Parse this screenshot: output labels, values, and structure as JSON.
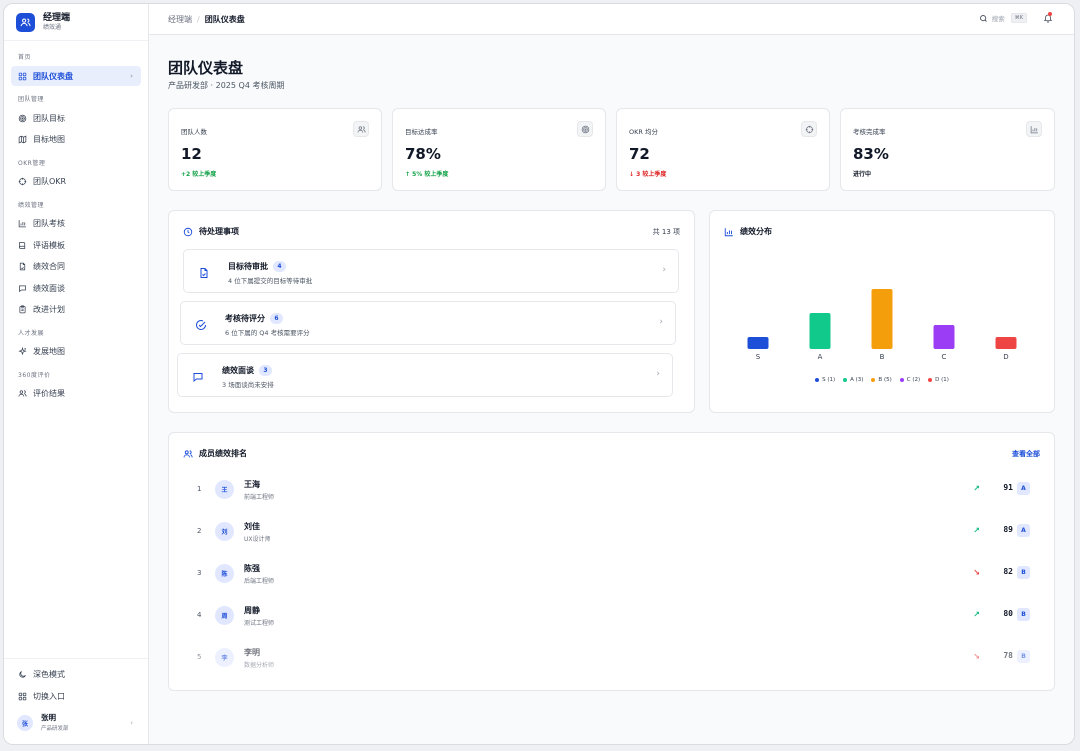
{
  "brand": {
    "name": "经理端",
    "sub": "绩效通"
  },
  "sidebar": {
    "groups": [
      {
        "title": "首页",
        "items": [
          {
            "label": "团队仪表盘",
            "icon": "dashboard-icon",
            "active": true
          }
        ]
      },
      {
        "title": "团队管理",
        "items": [
          {
            "label": "团队目标",
            "icon": "target-icon"
          },
          {
            "label": "目标地图",
            "icon": "map-icon"
          }
        ]
      },
      {
        "title": "OKR管理",
        "items": [
          {
            "label": "团队OKR",
            "icon": "crosshair-icon"
          }
        ]
      },
      {
        "title": "绩效管理",
        "items": [
          {
            "label": "团队考核",
            "icon": "bar-chart-icon"
          },
          {
            "label": "评语模板",
            "icon": "book-icon"
          },
          {
            "label": "绩效合同",
            "icon": "contract-icon"
          },
          {
            "label": "绩效面谈",
            "icon": "chat-icon"
          },
          {
            "label": "改进计划",
            "icon": "clipboard-icon"
          }
        ]
      },
      {
        "title": "人才发展",
        "items": [
          {
            "label": "发展地图",
            "icon": "sparkle-icon"
          }
        ]
      },
      {
        "title": "360度评价",
        "items": [
          {
            "label": "评价结果",
            "icon": "users-icon"
          }
        ]
      }
    ],
    "dark_mode": "深色模式",
    "switch_entry": "切换入口",
    "user": {
      "avatar": "张",
      "name": "张明",
      "dept": "产品研发部"
    }
  },
  "topbar": {
    "crumb_root": "经理端",
    "crumb_current": "团队仪表盘",
    "search_label": "搜索",
    "search_kbd": "⌘K"
  },
  "page": {
    "title": "团队仪表盘",
    "subtitle": "产品研发部 · 2025 Q4 考核周期"
  },
  "stats": [
    {
      "label": "团队人数",
      "value": "12",
      "delta": "+2 较上季度",
      "delta_color": "#16a34a",
      "icon": "users-icon"
    },
    {
      "label": "目标达成率",
      "value": "78%",
      "delta": "↑ 5% 较上季度",
      "delta_color": "#16a34a",
      "icon": "target-icon"
    },
    {
      "label": "OKR 均分",
      "value": "72",
      "delta": "↓ 3 较上季度",
      "delta_color": "#dc2626",
      "icon": "crosshair-icon"
    },
    {
      "label": "考核完成率",
      "value": "83%",
      "delta": "进行中",
      "delta_color": "#111827",
      "icon": "bar-chart-icon"
    }
  ],
  "todo": {
    "title": "待处理事项",
    "count": "共 13 项",
    "items": [
      {
        "title": "目标待审批",
        "badge": "4",
        "desc": "4 位下属提交的目标等待审批",
        "icon": "document-check-icon"
      },
      {
        "title": "考核待评分",
        "badge": "6",
        "desc": "6 位下属的 Q4 考核需要评分",
        "icon": "check-circle-icon"
      },
      {
        "title": "绩效面谈",
        "badge": "3",
        "desc": "3 场面谈尚未安排",
        "icon": "chat-icon"
      }
    ]
  },
  "distribution": {
    "title": "绩效分布"
  },
  "chart_data": {
    "type": "bar",
    "categories": [
      "S",
      "A",
      "B",
      "C",
      "D"
    ],
    "values": [
      1,
      3,
      5,
      2,
      1
    ],
    "colors": [
      "#1d4ed8",
      "#10c98a",
      "#f59e0b",
      "#9b3df5",
      "#ef4444"
    ],
    "legend": [
      "S (1)",
      "A (3)",
      "B (5)",
      "C (2)",
      "D (1)"
    ],
    "legend_position": "bottom",
    "ylim": [
      0,
      5
    ],
    "grid": false
  },
  "ranking": {
    "title": "成员绩效排名",
    "view_all": "查看全部",
    "members": [
      {
        "rank": "1",
        "avatar": "王",
        "name": "王海",
        "role": "前端工程师",
        "trend": "↗",
        "trend_color": "#10b981",
        "score": "91",
        "grade": "A"
      },
      {
        "rank": "2",
        "avatar": "刘",
        "name": "刘佳",
        "role": "UX设计师",
        "trend": "↗",
        "trend_color": "#10b981",
        "score": "89",
        "grade": "A"
      },
      {
        "rank": "3",
        "avatar": "陈",
        "name": "陈强",
        "role": "后端工程师",
        "trend": "↘",
        "trend_color": "#ef4444",
        "score": "82",
        "grade": "B"
      },
      {
        "rank": "4",
        "avatar": "周",
        "name": "周静",
        "role": "测试工程师",
        "trend": "↗",
        "trend_color": "#10b981",
        "score": "80",
        "grade": "B"
      },
      {
        "rank": "5",
        "avatar": "李",
        "name": "李明",
        "role": "数据分析师",
        "trend": "↘",
        "trend_color": "#ef4444",
        "score": "78",
        "grade": "B"
      }
    ]
  }
}
